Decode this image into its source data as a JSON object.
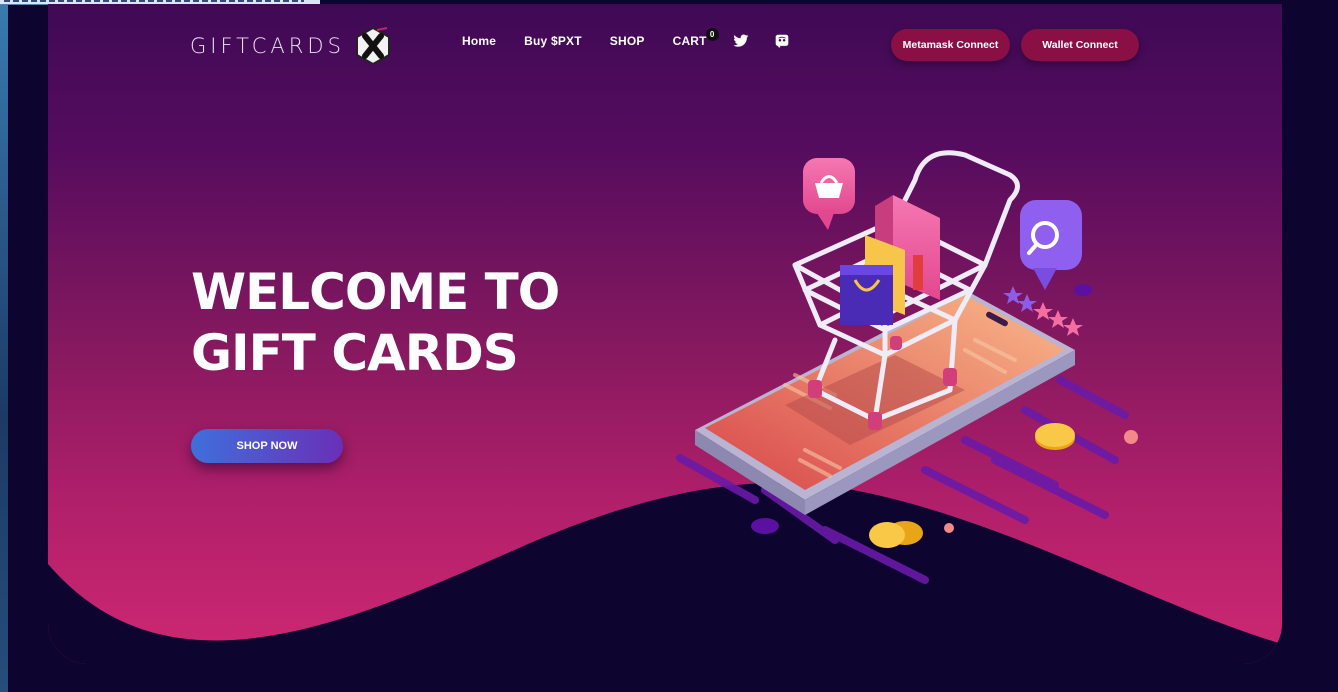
{
  "logo": {
    "text": "GIFTCARDS",
    "mark": "X"
  },
  "nav": {
    "home": "Home",
    "buy": "Buy $PXT",
    "shop": "SHOP",
    "cart": "CART",
    "cart_count": "0",
    "icons": [
      "twitter-icon",
      "discord-icon"
    ]
  },
  "buttons": {
    "metamask": "Metamask Connect",
    "wallet": "Wallet Connect"
  },
  "hero": {
    "title_line1": "WELCOME TO",
    "title_line2": "GIFT CARDS",
    "cta": "SHOP NOW"
  },
  "colors": {
    "background": "#0d0430",
    "hero_top": "#3f0a55",
    "hero_bottom": "#cf2872",
    "pill_button": "#8a0f45",
    "cta_left": "#3f6fdc",
    "cta_right": "#6a2fb8"
  }
}
